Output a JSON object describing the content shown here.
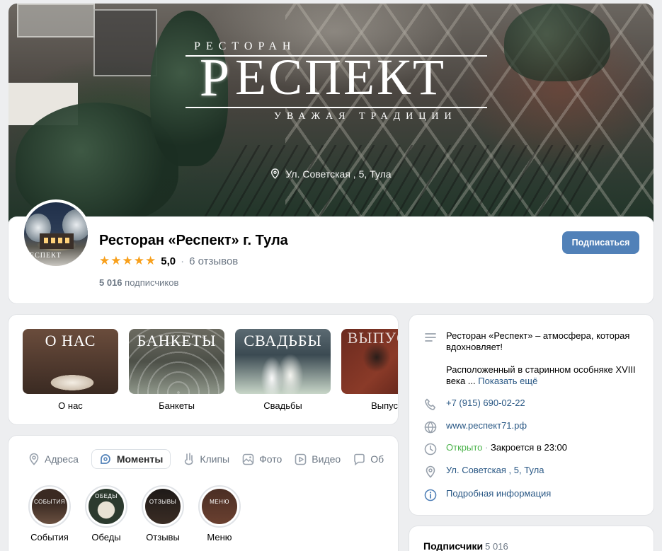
{
  "cover": {
    "logo_top": "РЕСТОРАН",
    "logo_letter": "Р",
    "logo_main": "ЕСПЕКТ",
    "logo_bottom": "УВАЖАЯ ТРАДИЦИИ",
    "address": "Ул. Советская , 5, Тула"
  },
  "profile": {
    "title": "Ресторан «Респект» г. Тула",
    "rating_value": "5,0",
    "rating_stars": 5,
    "reviews": "6 отзывов",
    "subscribers_count": "5 016",
    "subscribers_label": "подписчиков",
    "subscribe_button": "Подписаться"
  },
  "featured": [
    {
      "label": "О нас",
      "image_title": "О НАС"
    },
    {
      "label": "Банкеты",
      "image_title": "БАНКЕТЫ"
    },
    {
      "label": "Свадьбы",
      "image_title": "СВАДЬБЫ"
    },
    {
      "label": "Выпускн",
      "image_title": "ВЫПУСКН"
    }
  ],
  "tabs": [
    {
      "label": "Адреса",
      "icon": "location-icon"
    },
    {
      "label": "Моменты",
      "icon": "moments-icon",
      "active": true
    },
    {
      "label": "Клипы",
      "icon": "clips-icon"
    },
    {
      "label": "Фото",
      "icon": "photo-icon"
    },
    {
      "label": "Видео",
      "icon": "video-icon"
    },
    {
      "label": "Об",
      "icon": "discussion-icon"
    }
  ],
  "stories": [
    {
      "label": "События",
      "image_title": "СОБЫТИЯ"
    },
    {
      "label": "Обеды",
      "image_title": "ОБЕДЫ"
    },
    {
      "label": "Отзывы",
      "image_title": "ОТЗЫВЫ"
    },
    {
      "label": "Меню",
      "image_title": "МЕНЮ"
    }
  ],
  "info": {
    "description_line1": "Ресторан «Респект» – атмосфера, которая вдохновляет!",
    "description_line2": "Расположенный в старинном особняке XVIII века ...",
    "show_more": "Показать ещё",
    "phone": "+7 (915) 690-02-22",
    "website": "www.респект71.рф",
    "status_open": "Открыто",
    "status_dot": "·",
    "status_close": "Закроется в 23:00",
    "address": "Ул. Советская , 5, Тула",
    "more_info": "Подробная информация"
  },
  "followers": {
    "title": "Подписчики",
    "count": "5 016"
  },
  "colors": {
    "accent": "#5181b8",
    "link": "#2a5885",
    "open_green": "#4bb34b",
    "star": "#f8a01c",
    "background": "#edeef0"
  }
}
